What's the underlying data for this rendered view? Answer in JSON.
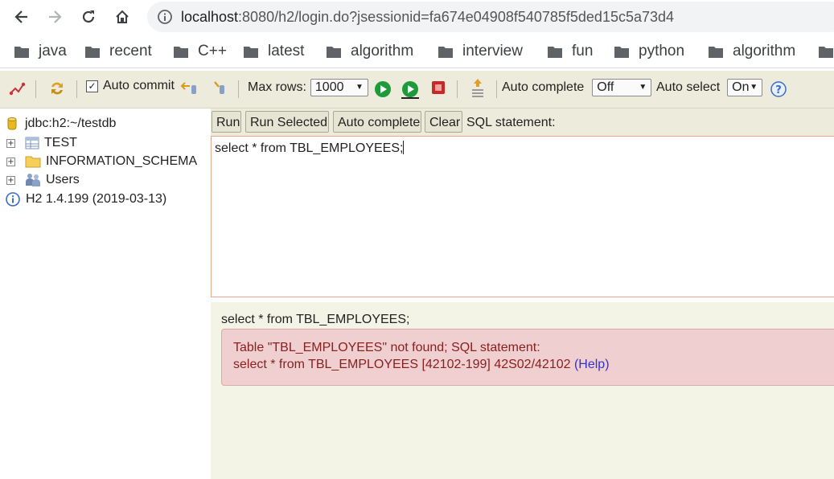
{
  "browser": {
    "url_host": "localhost",
    "url_rest": ":8080/h2/login.do?jsessionid=fa674e04908f540785f5ded15c5a73d4",
    "bookmarks": [
      "java",
      "recent",
      "C++",
      "latest",
      "algorithm",
      "interview",
      "fun",
      "python",
      "algorithm"
    ]
  },
  "toolbar": {
    "auto_commit_label": "Auto commit",
    "auto_commit_checked": true,
    "max_rows_label": "Max rows:",
    "max_rows_value": "1000",
    "auto_complete_label": "Auto complete",
    "auto_complete_value": "Off",
    "auto_select_label": "Auto select",
    "auto_select_value": "On"
  },
  "tree": {
    "connection": "jdbc:h2:~/testdb",
    "nodes": [
      "TEST",
      "INFORMATION_SCHEMA",
      "Users"
    ],
    "version": "H2 1.4.199 (2019-03-13)"
  },
  "query": {
    "buttons": [
      "Run",
      "Run Selected",
      "Auto complete",
      "Clear"
    ],
    "label": "SQL statement:",
    "sql_text": "select * from TBL_EMPLOYEES;"
  },
  "result": {
    "statement": "select * from TBL_EMPLOYEES;",
    "error_line1": "Table \"TBL_EMPLOYEES\" not found; SQL statement:",
    "error_line2": "select * from TBL_EMPLOYEES [42102-199] 42S02/42102",
    "help_link": "(Help)"
  },
  "colors": {
    "toolbar_bg": "#ecebdc",
    "result_bg": "#f4f4e6",
    "error_bg": "#efcfcf",
    "error_text": "#8a2020",
    "link": "#3333cc"
  }
}
